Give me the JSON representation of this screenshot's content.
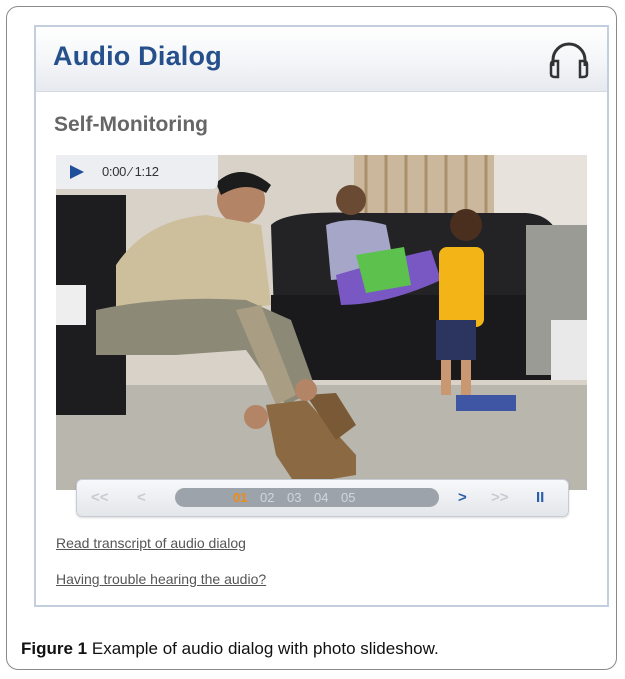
{
  "widget": {
    "title": "Audio Dialog",
    "header_icon": "headphones-icon",
    "subtitle": "Self-Monitoring"
  },
  "player": {
    "play_icon": "play-icon",
    "time": "0:00 ⁄ 1:12",
    "photo_description": "soldier lacing boots in living room while woman and toddler sit on couch",
    "controls": {
      "first": "<<",
      "previous": "<",
      "next": ">",
      "last": ">>",
      "pause": "II"
    },
    "slides": [
      "01",
      "02",
      "03",
      "04",
      "05"
    ],
    "current_slide": "01"
  },
  "links": {
    "transcript": "Read transcript of audio dialog",
    "trouble": "Having trouble hearing the audio?"
  },
  "caption": {
    "label": "Figure 1",
    "text": "Example of audio dialog with photo slideshow."
  },
  "colors": {
    "title": "#26508c",
    "accent": "#2b5ea8",
    "current_slide": "#f28a12",
    "border": "#c3cfdf"
  }
}
